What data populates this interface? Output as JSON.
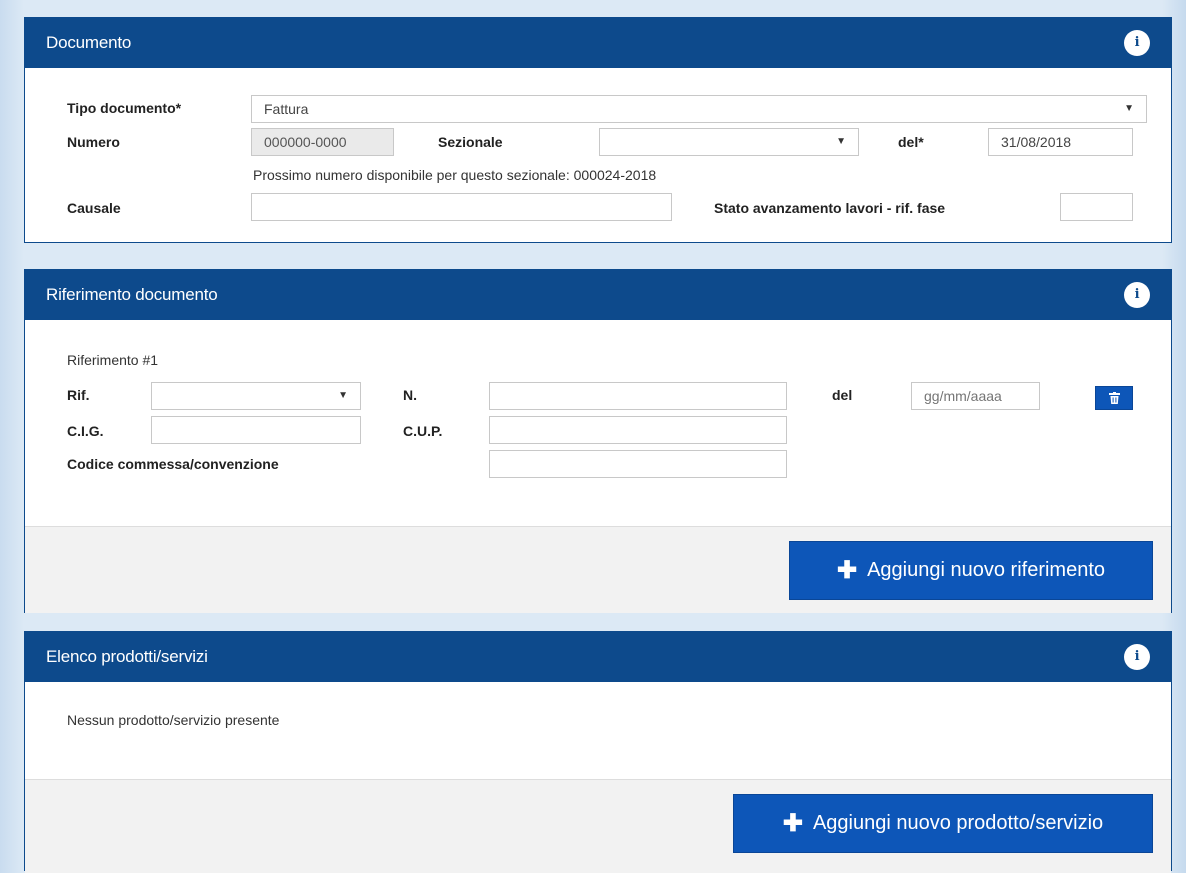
{
  "documento": {
    "title": "Documento",
    "info_icon": "info-icon",
    "tipo_documento_label": "Tipo documento*",
    "tipo_documento_value": "Fattura",
    "numero_label": "Numero",
    "numero_value": "000000-0000",
    "sezionale_label": "Sezionale",
    "sezionale_value": "",
    "del_label": "del*",
    "del_value": "31/08/2018",
    "prossimo_numero": "Prossimo numero disponibile per questo sezionale: 000024-2018",
    "causale_label": "Causale",
    "causale_value": "",
    "sal_label": "Stato avanzamento lavori - rif. fase",
    "sal_value": ""
  },
  "riferimento": {
    "title": "Riferimento documento",
    "info_icon": "info-icon",
    "item_title": "Riferimento #1",
    "rif_label": "Rif.",
    "rif_value": "",
    "n_label": "N.",
    "n_value": "",
    "del_label": "del",
    "del_placeholder": "gg/mm/aaaa",
    "cig_label": "C.I.G.",
    "cig_value": "",
    "cup_label": "C.U.P.",
    "cup_value": "",
    "commessa_label": "Codice commessa/convenzione",
    "commessa_value": "",
    "delete_icon": "trash-icon",
    "add_button": "Aggiungi nuovo riferimento"
  },
  "prodotti": {
    "title": "Elenco prodotti/servizi",
    "info_icon": "info-icon",
    "empty_text": "Nessun prodotto/servizio presente",
    "add_button": "Aggiungi nuovo prodotto/servizio"
  },
  "colors": {
    "header_blue": "#0d4a8c",
    "button_blue": "#0d56b8"
  }
}
